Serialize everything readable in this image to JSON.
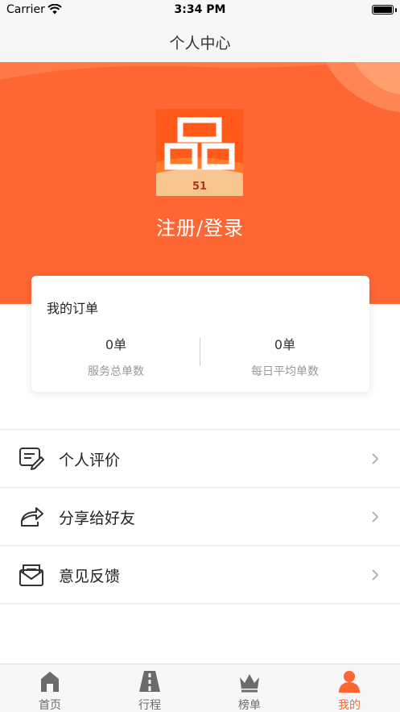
{
  "status_bar": {
    "carrier": "Carrier",
    "time": "3:34 PM"
  },
  "nav": {
    "title": "个人中心"
  },
  "hero": {
    "login_label": "注册/登录",
    "logo_text": "51",
    "accent_color": "#fe6633"
  },
  "orders": {
    "title": "我的订单",
    "stats": [
      {
        "value": "0单",
        "label": "服务总单数"
      },
      {
        "value": "0单",
        "label": "每日平均单数"
      }
    ]
  },
  "menu": [
    {
      "label": "个人评价",
      "icon": "review-edit-icon"
    },
    {
      "label": "分享给好友",
      "icon": "share-icon"
    },
    {
      "label": "意见反馈",
      "icon": "feedback-mail-icon"
    }
  ],
  "tabs": [
    {
      "label": "首页",
      "icon": "home-icon",
      "active": false
    },
    {
      "label": "行程",
      "icon": "road-icon",
      "active": false
    },
    {
      "label": "榜单",
      "icon": "crown-icon",
      "active": false
    },
    {
      "label": "我的",
      "icon": "user-icon",
      "active": true
    }
  ]
}
